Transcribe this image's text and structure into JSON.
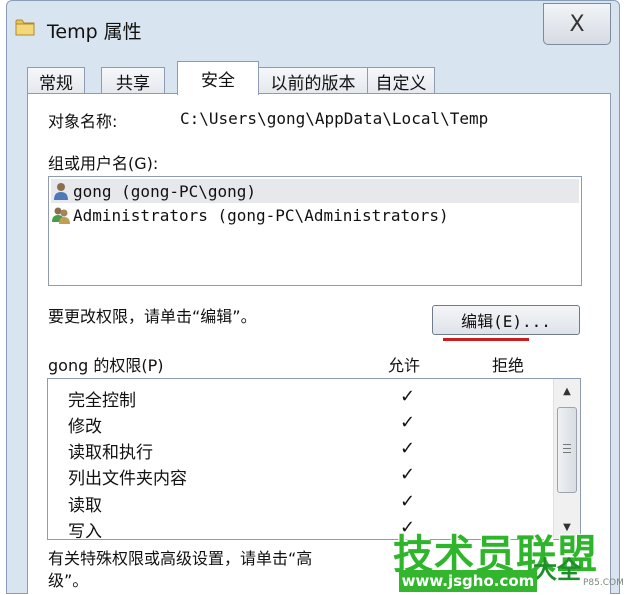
{
  "window": {
    "title": "Temp 属性",
    "close_label": "X"
  },
  "tabs": [
    {
      "label": "常规",
      "active": false
    },
    {
      "label": "共享",
      "active": false
    },
    {
      "label": "安全",
      "active": true
    },
    {
      "label": "以前的版本",
      "active": false
    },
    {
      "label": "自定义",
      "active": false
    }
  ],
  "security": {
    "object_name_label": "对象名称:",
    "object_name_value": "C:\\Users\\gong\\AppData\\Local\\Temp",
    "group_label": "组或用户名(G):",
    "users": [
      {
        "name": "gong (gong-PC\\gong)",
        "icon": "user-icon",
        "selected": true
      },
      {
        "name": "Administrators (gong-PC\\Administrators)",
        "icon": "group-icon",
        "selected": false
      }
    ],
    "change_hint": "要更改权限，请单击“编辑”。",
    "edit_button": "编辑(E)...",
    "perm_label": "gong 的权限(P)",
    "allow_header": "允许",
    "deny_header": "拒绝",
    "permissions": [
      {
        "name": "完全控制",
        "allow": "✓"
      },
      {
        "name": "修改",
        "allow": "✓"
      },
      {
        "name": "读取和执行",
        "allow": "✓"
      },
      {
        "name": "列出文件夹内容",
        "allow": "✓"
      },
      {
        "name": "读取",
        "allow": "✓"
      },
      {
        "name": "写入",
        "allow": "✓"
      }
    ],
    "advanced_hint_line1": "有关特殊权限或高级设置，请单击“高",
    "advanced_hint_line2": "级”。"
  },
  "watermark": {
    "main": "技术员联盟",
    "sub": "大全",
    "url": "www.jsgho.com",
    "small": "P85.COM"
  },
  "colors": {
    "accent_red": "#c81e1e",
    "watermark_green": "#2fb52b",
    "chrome": "#d9e4f1"
  }
}
